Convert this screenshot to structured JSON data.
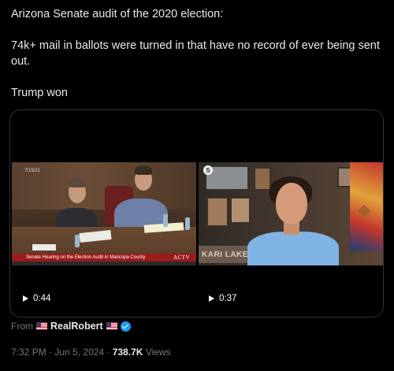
{
  "tweet": {
    "line1": "Arizona Senate audit of the 2020 election:",
    "line2": "74k+ mail in ballots were turned in that have no record of ever being sent out.",
    "line3": "Trump won"
  },
  "media": {
    "left_video": {
      "date_stamp": "7/15/21",
      "lower_third": "Senate Hearing on the Election Audit in Maricopa County",
      "channel_logo": "ACTV",
      "duration": "0:44"
    },
    "right_video": {
      "badge": "S",
      "sign_text": "KARI LAKE",
      "duration": "0:37"
    }
  },
  "source": {
    "from_label": "From",
    "author": "RealRobert"
  },
  "meta": {
    "time": "7:32 PM",
    "separator1": " · ",
    "date": "Jun 5, 2024",
    "separator2": " · ",
    "views_count": "738.7K",
    "views_label": " Views"
  }
}
